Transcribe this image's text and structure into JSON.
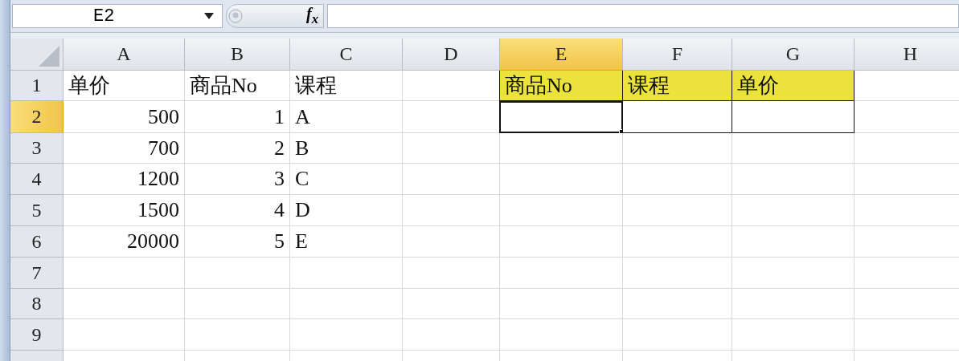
{
  "name_box": {
    "value": "E2"
  },
  "formula_bar": {
    "fx_label": "f$_{x}$"
  },
  "columns": [
    {
      "label": "A",
      "selected": false
    },
    {
      "label": "B",
      "selected": false
    },
    {
      "label": "C",
      "selected": false
    },
    {
      "label": "D",
      "selected": false
    },
    {
      "label": "E",
      "selected": true
    },
    {
      "label": "F",
      "selected": false
    },
    {
      "label": "G",
      "selected": false
    },
    {
      "label": "H",
      "selected": false
    }
  ],
  "rows": [
    {
      "label": "1",
      "selected": false,
      "cells": [
        {
          "text": "单价",
          "kind": "text"
        },
        {
          "text": "商品No",
          "kind": "text"
        },
        {
          "text": "课程",
          "kind": "text"
        },
        null,
        {
          "text": "商品No",
          "kind": "text",
          "highlighted": true,
          "bordered": true
        },
        {
          "text": "课程",
          "kind": "text",
          "highlighted": true,
          "bordered": true
        },
        {
          "text": "单价",
          "kind": "text",
          "highlighted": true,
          "bordered": true
        },
        null
      ]
    },
    {
      "label": "2",
      "selected": true,
      "cells": [
        {
          "text": "500",
          "kind": "number"
        },
        {
          "text": "1",
          "kind": "number"
        },
        {
          "text": "A",
          "kind": "text"
        },
        null,
        {
          "bordered": true,
          "active": true
        },
        {
          "bordered": true
        },
        {
          "bordered": true
        },
        null
      ]
    },
    {
      "label": "3",
      "selected": false,
      "cells": [
        {
          "text": "700",
          "kind": "number"
        },
        {
          "text": "2",
          "kind": "number"
        },
        {
          "text": "B",
          "kind": "text"
        },
        null,
        null,
        null,
        null,
        null
      ]
    },
    {
      "label": "4",
      "selected": false,
      "cells": [
        {
          "text": "1200",
          "kind": "number"
        },
        {
          "text": "3",
          "kind": "number"
        },
        {
          "text": "C",
          "kind": "text"
        },
        null,
        null,
        null,
        null,
        null
      ]
    },
    {
      "label": "5",
      "selected": false,
      "cells": [
        {
          "text": "1500",
          "kind": "number"
        },
        {
          "text": "4",
          "kind": "number"
        },
        {
          "text": "D",
          "kind": "text"
        },
        null,
        null,
        null,
        null,
        null
      ]
    },
    {
      "label": "6",
      "selected": false,
      "cells": [
        {
          "text": "20000",
          "kind": "number"
        },
        {
          "text": "5",
          "kind": "number"
        },
        {
          "text": "E",
          "kind": "text"
        },
        null,
        null,
        null,
        null,
        null
      ]
    },
    {
      "label": "7",
      "selected": false,
      "cells": [
        null,
        null,
        null,
        null,
        null,
        null,
        null,
        null
      ]
    },
    {
      "label": "8",
      "selected": false,
      "cells": [
        null,
        null,
        null,
        null,
        null,
        null,
        null,
        null
      ]
    },
    {
      "label": "9",
      "selected": false,
      "cells": [
        null,
        null,
        null,
        null,
        null,
        null,
        null,
        null
      ]
    }
  ]
}
